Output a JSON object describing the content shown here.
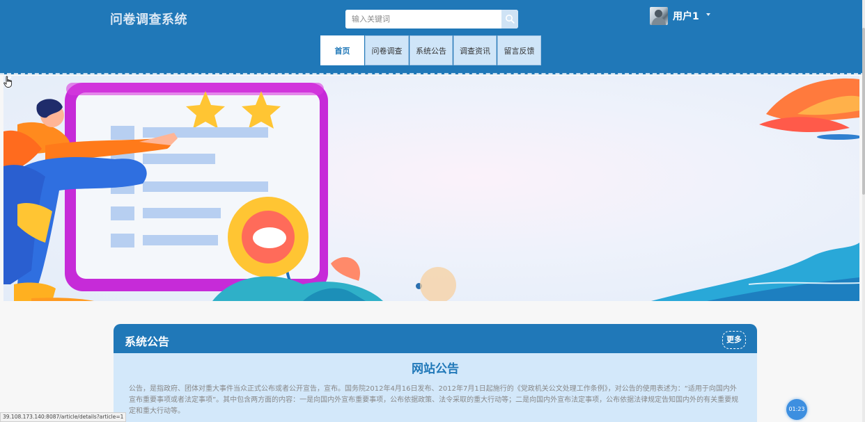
{
  "header": {
    "site_title": "问卷调查系统",
    "search_placeholder": "输入关键词",
    "user_name": "用户1",
    "bg_color": "#2078b8"
  },
  "nav": {
    "items": [
      {
        "label": "首页",
        "active": true
      },
      {
        "label": "问卷调查",
        "active": false
      },
      {
        "label": "系统公告",
        "active": false
      },
      {
        "label": "调查资讯",
        "active": false
      },
      {
        "label": "留言反馈",
        "active": false
      }
    ]
  },
  "banner": {
    "icons": [
      "chevron-left-icon",
      "chevron-right-icon"
    ],
    "indicator_count": 1
  },
  "notice": {
    "section_title": "系统公告",
    "more_label": "更多",
    "article_title": "网站公告",
    "article_body": "公告，是指政府、团体对重大事件当众正式公布或者公开宣告，宣布。国务院2012年4月16日发布、2012年7月1日起施行的《党政机关公文处理工作条例》，对公告的使用表述为：“适用于向国内外宣布重要事项或者法定事项”。其中包含两方面的内容：一是向国内外宣布重要事项，公布依据政策、法令采取的重大行动等；二是向国内外宣布法定事项，公布依据法律规定告知国内外的有关重要规定和重大行动等。"
  },
  "status_bar": {
    "url": "39.108.173.140:8087/article/details?article=1"
  },
  "timer": "01:23"
}
